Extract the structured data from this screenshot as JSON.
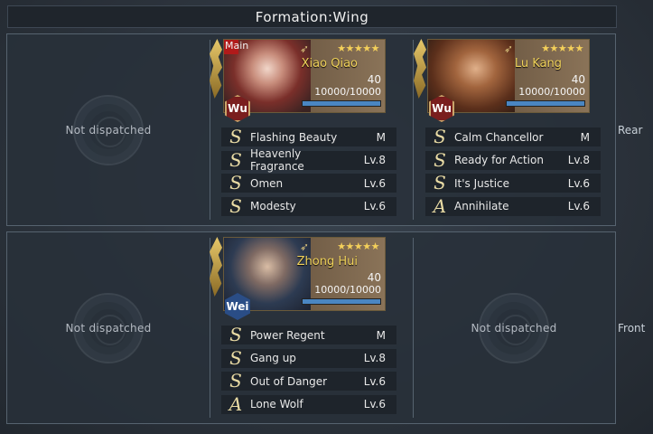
{
  "title": "Formation:Wing",
  "side_labels": {
    "rear": "Rear",
    "front": "Front"
  },
  "empty_slot_text": "Not dispatched",
  "rear": {
    "generals": [
      {
        "name": "Xiao Qiao",
        "main_tag": "Main",
        "faction": "Wu",
        "stars": "★★★★★",
        "level": "40",
        "troops": "10000/10000",
        "troop_fraction": 1.0,
        "skills": [
          {
            "grade": "S",
            "name": "Flashing Beauty",
            "level": "M"
          },
          {
            "grade": "S",
            "name": "Heavenly Fragrance",
            "level": "Lv.8"
          },
          {
            "grade": "S",
            "name": "Omen",
            "level": "Lv.6"
          },
          {
            "grade": "S",
            "name": "Modesty",
            "level": "Lv.6"
          }
        ]
      },
      {
        "name": "Lu Kang",
        "faction": "Wu",
        "stars": "★★★★★",
        "level": "40",
        "troops": "10000/10000",
        "troop_fraction": 1.0,
        "skills": [
          {
            "grade": "S",
            "name": "Calm Chancellor",
            "level": "M"
          },
          {
            "grade": "S",
            "name": "Ready for Action",
            "level": "Lv.8"
          },
          {
            "grade": "S",
            "name": "It's Justice",
            "level": "Lv.6"
          },
          {
            "grade": "A",
            "name": "Annihilate",
            "level": "Lv.6"
          }
        ]
      }
    ]
  },
  "front": {
    "generals": [
      {
        "name": "Zhong Hui",
        "faction": "Wei",
        "stars": "★★★★★",
        "level": "40",
        "troops": "10000/10000",
        "troop_fraction": 1.0,
        "skills": [
          {
            "grade": "S",
            "name": "Power Regent",
            "level": "M"
          },
          {
            "grade": "S",
            "name": "Gang up",
            "level": "Lv.8"
          },
          {
            "grade": "S",
            "name": "Out of Danger",
            "level": "Lv.6"
          },
          {
            "grade": "A",
            "name": "Lone Wolf",
            "level": "Lv.6"
          }
        ]
      }
    ]
  },
  "colors": {
    "name_gold": "#f0d25a",
    "star_gold": "#f4d05a",
    "troop_bar": "#4a86c2",
    "wu_red": "#7a1e1e",
    "wei_blue": "#2a4d86"
  },
  "icons": {
    "star": "star-icon",
    "feather": "feather-icon",
    "wing": "gold-wing-icon",
    "emblem": "empty-slot-emblem-icon"
  }
}
